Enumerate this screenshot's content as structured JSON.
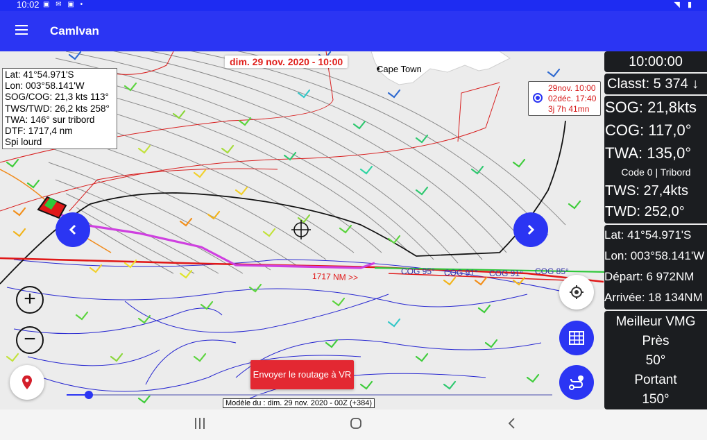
{
  "status": {
    "time": "10:02",
    "left_icons": "▣ ✉ ▣ •",
    "right_icons": "◥ ▮"
  },
  "app": {
    "title": "Camlvan"
  },
  "map": {
    "date_label": "dim. 29 nov. 2020 - 10:00",
    "city_label": "Cape Town",
    "info": {
      "lat": "Lat:  41°54.971'S",
      "lon": "Lon: 003°58.141'W",
      "sog_cog": "SOG/COG: 21,3 kts 113°",
      "tws_twd": "TWS/TWD: 26,2 kts 258°",
      "twa": "TWA: 146° sur tribord",
      "dtf": "DTF: 1717,4 nm",
      "sail": "Spi lourd"
    },
    "eta": {
      "start": "29nov. 10:00",
      "arrival": "02déc. 17:40",
      "duration": "3j 7h 41mn"
    },
    "route_label": "1717 NM >>",
    "cog_labels": [
      "COG 95°",
      "COG 91°",
      "COG 91°",
      "COG 85°"
    ],
    "send_button": "Envoyer le routage à VR",
    "model_label": "Modèle du : dim. 29 nov. 2020 - 00Z (+384)",
    "slider_value": 0.04,
    "colors": {
      "route": "#cf40e0",
      "orthodromy": "#e01818",
      "track": "#111111",
      "accent": "#2b35f3"
    }
  },
  "panel": {
    "time": "10:00:00",
    "rank": "Classt: 5 374 ↓",
    "sog": "SOG: 21,8kts",
    "cog": "COG: 117,0°",
    "twa": "TWA: 135,0°",
    "code": "Code 0 | Tribord",
    "tws": "TWS: 27,4kts",
    "twd": "TWD: 252,0°",
    "lat": "Lat:  41°54.971'S",
    "lon": "Lon: 003°58.141'W",
    "depart": "Départ: 6 972NM",
    "arrivee": "Arrivée: 18 134NM",
    "vmg_title": "Meilleur VMG",
    "vmg_upwind": "Près",
    "vmg_upwind_angle": "50°",
    "vmg_downwind": "Portant",
    "vmg_downwind_angle": "150°"
  },
  "icons": [
    "menu-icon",
    "chevron-left-icon",
    "chevron-right-icon",
    "zoom-in-icon",
    "zoom-out-icon",
    "location-pin-icon",
    "target-icon",
    "table-icon",
    "route-icon",
    "crosshair-icon"
  ]
}
